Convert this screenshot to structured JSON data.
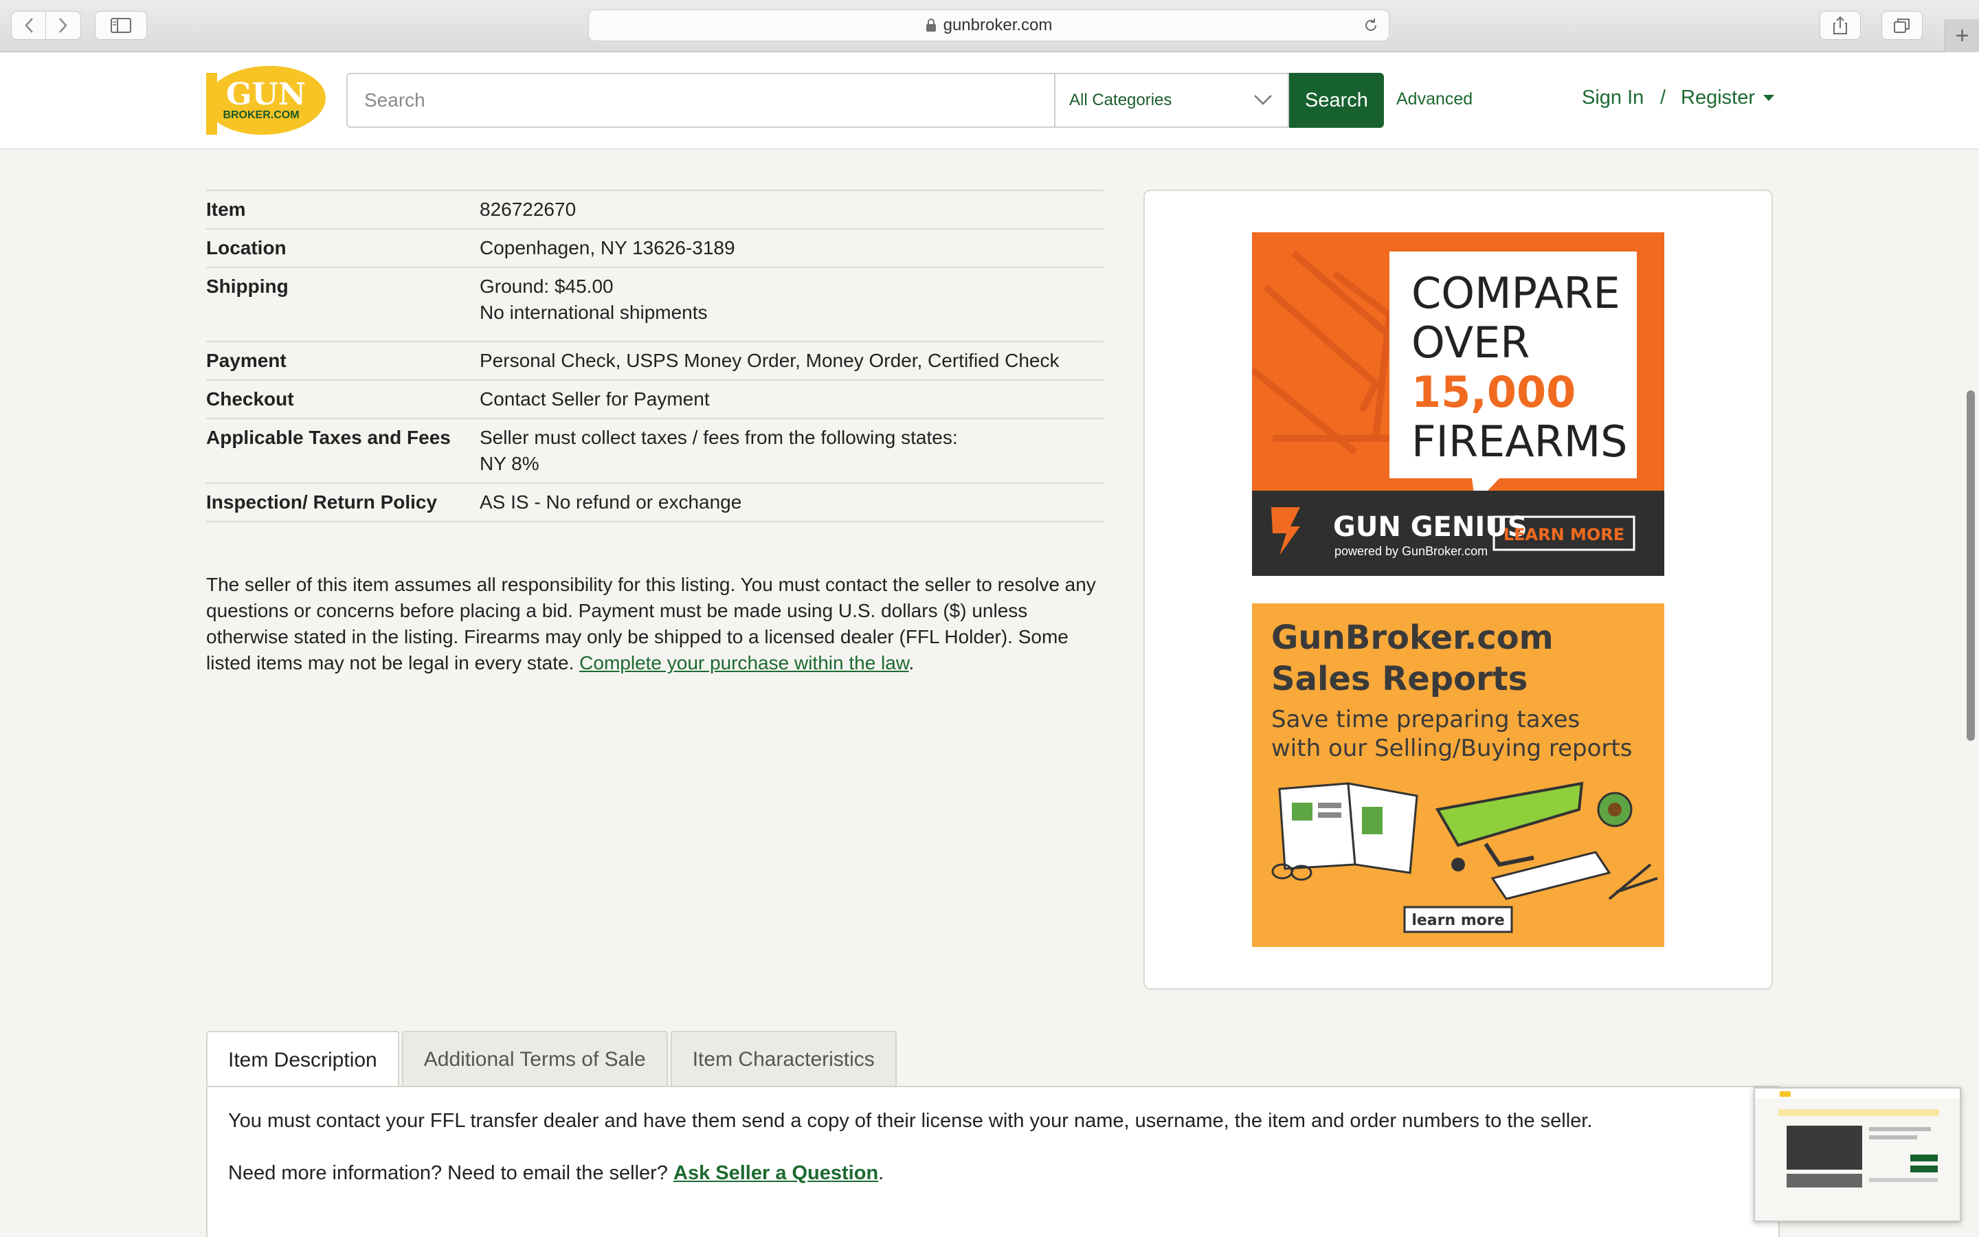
{
  "browser": {
    "url": "gunbroker.com"
  },
  "header": {
    "logo_text_top": "GUN",
    "logo_text_bottom": "BROKER.COM",
    "search_placeholder": "Search",
    "category_selected": "All Categories",
    "search_button": "Search",
    "advanced_link": "Advanced",
    "sign_in": "Sign In",
    "separator": "/",
    "register": "Register"
  },
  "details": [
    {
      "label": "Item",
      "value": "826722670",
      "value2": ""
    },
    {
      "label": "Location",
      "value": "Copenhagen, NY 13626-3189",
      "value2": ""
    },
    {
      "label": "Shipping",
      "value": "Ground: $45.00",
      "value2": "No international shipments"
    },
    {
      "label": "Payment",
      "value": "Personal Check, USPS Money Order, Money Order, Certified Check",
      "value2": ""
    },
    {
      "label": "Checkout",
      "value": "Contact Seller for Payment",
      "value2": ""
    },
    {
      "label": "Applicable Taxes and Fees",
      "value": "Seller must collect taxes / fees from the following states:",
      "value2": "NY 8%"
    },
    {
      "label": "Inspection/ Return Policy",
      "value": "AS IS - No refund or exchange",
      "value2": ""
    }
  ],
  "disclaimer": {
    "text": "The seller of this item assumes all responsibility for this listing. You must contact the seller to resolve any questions or concerns before placing a bid. Payment must be made using U.S. dollars ($) unless otherwise stated in the listing. Firearms may only be shipped to a licensed dealer (FFL Holder). Some listed items may not be legal in every state. ",
    "link": "Complete your purchase within the law",
    "end": "."
  },
  "ads": {
    "ad1": {
      "line1": "COMPARE",
      "line2": "OVER",
      "line3": "15,000",
      "line4": "FIREARMS",
      "brand": "GUN GENIUS",
      "brand_sub": "powered by GunBroker.com",
      "cta": "LEARN MORE"
    },
    "ad2": {
      "title1": "GunBroker.com",
      "title2": "Sales Reports",
      "sub1": "Save time preparing taxes",
      "sub2": "with our Selling/Buying reports",
      "cta": "learn more"
    }
  },
  "tabs": [
    {
      "label": "Item Description",
      "active": true
    },
    {
      "label": "Additional Terms of Sale",
      "active": false
    },
    {
      "label": "Item Characteristics",
      "active": false
    }
  ],
  "tab_content": {
    "line1": "You must contact your FFL transfer dealer and have them send a copy of their license with your name, username, the item and order numbers to the seller.",
    "line2_prefix": "Need more information? Need to email the seller? ",
    "line2_link": "Ask Seller a Question",
    "line2_end": "."
  },
  "colors": {
    "brand_green": "#17612e",
    "link_green": "#1c6a30",
    "logo_yellow": "#f7c325",
    "ad_orange": "#f06a1f",
    "ad2_orange": "#f8a93a"
  }
}
